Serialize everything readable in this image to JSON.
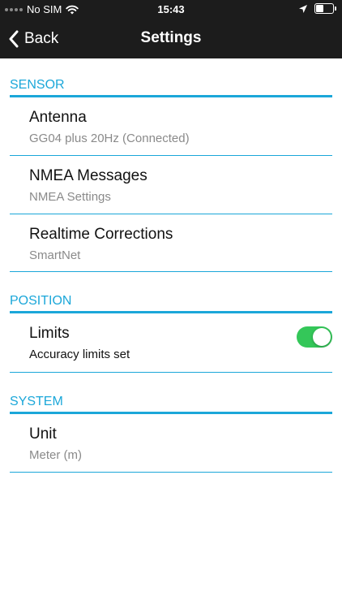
{
  "status_bar": {
    "carrier": "No SIM",
    "time": "15:43"
  },
  "nav": {
    "back_label": "Back",
    "title": "Settings"
  },
  "sections": {
    "sensor": {
      "header": "SENSOR",
      "items": [
        {
          "title": "Antenna",
          "subtitle": "GG04 plus 20Hz (Connected)"
        },
        {
          "title": "NMEA Messages",
          "subtitle": "NMEA Settings"
        },
        {
          "title": "Realtime Corrections",
          "subtitle": "SmartNet"
        }
      ]
    },
    "position": {
      "header": "POSITION",
      "items": [
        {
          "title": "Limits",
          "subtitle": "Accuracy limits set",
          "toggle_on": true
        }
      ]
    },
    "system": {
      "header": "SYSTEM",
      "items": [
        {
          "title": "Unit",
          "subtitle": "Meter (m)"
        }
      ]
    }
  },
  "colors": {
    "accent": "#1ba7d9",
    "toggle_on": "#34c759",
    "topbar": "#1c1c1c"
  }
}
